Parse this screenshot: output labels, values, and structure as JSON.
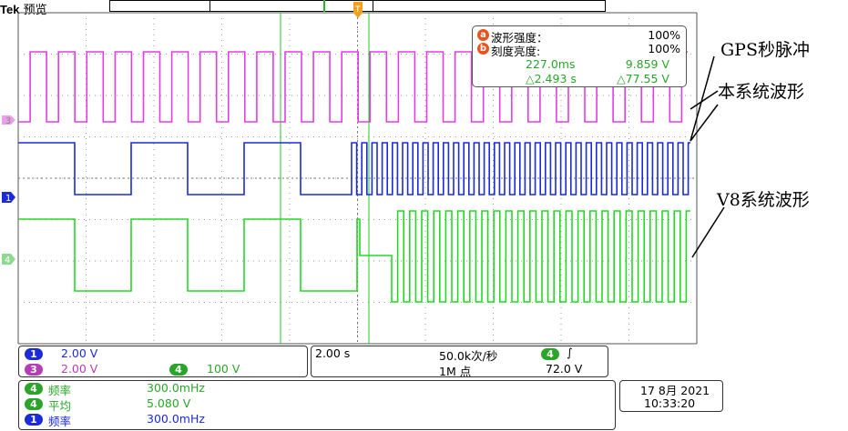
{
  "header": {
    "brand": "Tek",
    "mode": "预览"
  },
  "colors": {
    "ch3": "#e23ee3",
    "ch1": "#1b2bd8",
    "ch4": "#26d826",
    "grid": "#9a9a9a",
    "accent": "#e8541c"
  },
  "markers": {
    "trigger_marker": "T",
    "ch3_marker": "3",
    "ch1_marker": "1",
    "ch4_marker": "4"
  },
  "measurements": {
    "row1_badge": "a",
    "row1_label": "波形强度：",
    "row1_value": "100%",
    "row2_badge": "b",
    "row2_label": "刻度亮度:",
    "row2_value": "100%",
    "cursor_time": "227.0ms",
    "cursor_volt": "9.859 V",
    "delta_time": "△2.493 s",
    "delta_volt": "△77.55 V"
  },
  "annotations": {
    "gps": "GPS秒脉冲",
    "this_system": "本系统波形",
    "v8_system": "V8系统波形"
  },
  "vertical_panel": {
    "ch1_badge": "1",
    "ch1_scale": "2.00 V",
    "ch3_badge": "3",
    "ch3_scale": "2.00 V",
    "ch4_badge": "4",
    "ch4_scale": "100 V"
  },
  "horizontal_panel": {
    "timebase": "2.00 s",
    "sample_rate": "50.0k次/秒",
    "record_length": "1M 点",
    "trigger_badge": "4",
    "trigger_slope": "∫",
    "trigger_level": "72.0 V"
  },
  "stats_panel": {
    "rows": [
      {
        "badge": "4",
        "label": "频率",
        "value": "300.0mHz"
      },
      {
        "badge": "4",
        "label": "平均",
        "value": "5.080 V"
      },
      {
        "badge": "1",
        "label": "频率",
        "value": "300.0mHz"
      }
    ]
  },
  "datetime": {
    "date": "17 8月 2021",
    "time": "10:33:20"
  }
}
